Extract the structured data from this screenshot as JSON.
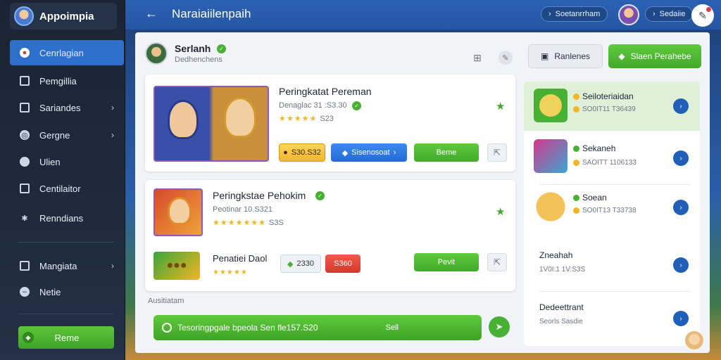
{
  "app": {
    "name": "Appoimpia"
  },
  "sidebar": {
    "items": [
      {
        "label": "Cenrlagian"
      },
      {
        "label": "Pemgillia"
      },
      {
        "label": "Sariandes"
      },
      {
        "label": "Gergne"
      },
      {
        "label": "Ulien"
      },
      {
        "label": "Centilaitor"
      },
      {
        "label": "Renndians"
      },
      {
        "label": "Mangiata"
      },
      {
        "label": "Netie"
      }
    ],
    "button_label": "Reme"
  },
  "topbar": {
    "title": "Naraiaiilenpaih",
    "pill1": "Soetanrrham",
    "pill2": "Sedaiie"
  },
  "header": {
    "user_name": "Serlanh",
    "user_sub": "Dedhenchens",
    "btn_light": "Ranlenes",
    "btn_green": "Slaen Perahebe"
  },
  "card1": {
    "title": "Peringkatat Pereman",
    "meta": "Denaglac 31 :S3.30",
    "rating": "S23",
    "btn_yellow": "S30.S32",
    "btn_blue": "Sisenosoat",
    "btn_green": "Beme"
  },
  "card2": {
    "title": "Peringkstae Pehokim",
    "meta": "Peotinar 10.S321",
    "rating": "S3S",
    "badge_label": "Penatiei Daol",
    "btn_light": "2330",
    "btn_red": "S360",
    "btn_green": "Pevit"
  },
  "bottom": {
    "section_label": "Ausitiatam",
    "bar_text": "Tesoringpgale bpeola Sen fle157.S20",
    "bar_right": "Sell"
  },
  "right_list": [
    {
      "name": "Seiloteriaidan",
      "meta": "SO0IT11 T36439"
    },
    {
      "name": "Sekaneh",
      "meta": "SAOITT 1106133"
    },
    {
      "name": "Soean",
      "meta": "SO0IT13 T33738"
    },
    {
      "name": "Zneahah",
      "meta": "1V0I:1 1V:S3S"
    },
    {
      "name": "Dedeettrant",
      "meta": "Seorls Sasdie"
    }
  ],
  "colors": {
    "accent": "#2e6fcc",
    "primary_green": "#46b132",
    "danger_red": "#d33a2c",
    "gold": "#f3b623"
  }
}
